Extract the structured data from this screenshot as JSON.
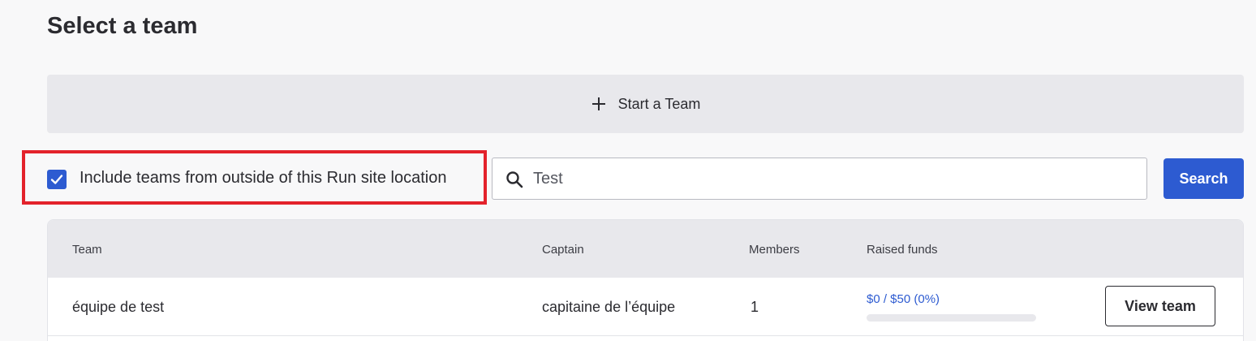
{
  "page": {
    "title": "Select a team"
  },
  "start_team": {
    "label": "Start a Team",
    "icon": "plus-icon"
  },
  "filter": {
    "include_outside_label": "Include teams from outside of this Run site location",
    "include_outside_checked": true
  },
  "search": {
    "value": "Test",
    "button_label": "Search",
    "icon": "search-icon"
  },
  "table": {
    "headers": [
      "Team",
      "Captain",
      "Members",
      "Raised funds"
    ],
    "rows": [
      {
        "team": "équipe de test",
        "captain": "capitaine de l’équipe",
        "members": "1",
        "raised": "$0 /  $50  (0%)",
        "progress_percent": 0,
        "action_label": "View team"
      }
    ]
  },
  "colors": {
    "accent": "#2d5bd1",
    "highlight": "#e3222b",
    "panel": "#e8e8ec"
  }
}
